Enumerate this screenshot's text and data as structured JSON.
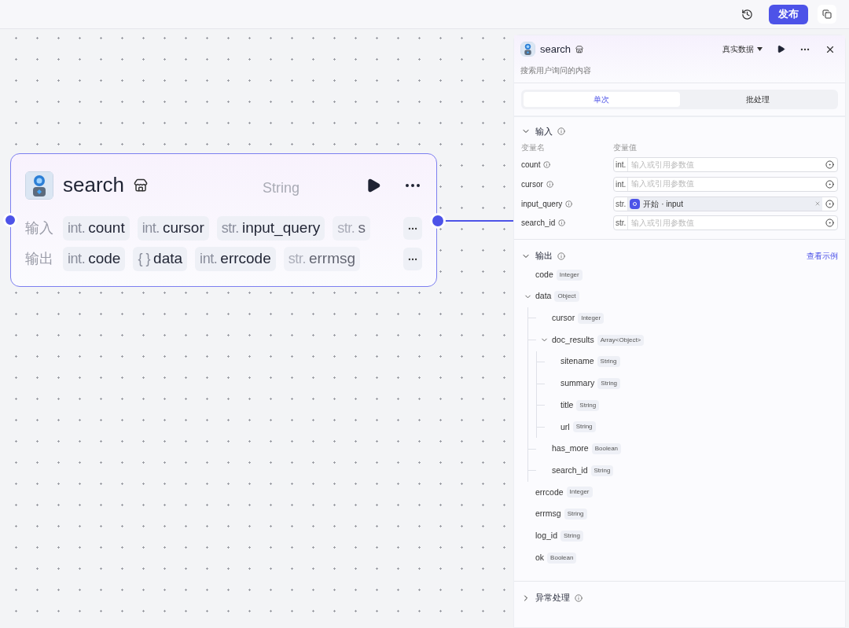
{
  "toolbar": {
    "publish": "发布"
  },
  "node": {
    "title": "search",
    "ghost_label": "String",
    "input_label": "输入",
    "output_label": "输出",
    "inputs": [
      {
        "type": "int.",
        "name": "count",
        "faded": false
      },
      {
        "type": "int.",
        "name": "cursor",
        "faded": false
      },
      {
        "type": "str.",
        "name": "input_query",
        "faded": false
      },
      {
        "type": "str.",
        "name": "s",
        "faded": true
      }
    ],
    "outputs": [
      {
        "type": "int.",
        "name": "code",
        "faded": false
      },
      {
        "type": "{ }",
        "name": "data",
        "faded": false
      },
      {
        "type": "int.",
        "name": "errcode",
        "faded": false
      },
      {
        "type": "str.",
        "name": "errmsg",
        "faded": true
      }
    ]
  },
  "panel": {
    "title": "search",
    "description": "搜索用户询问的内容",
    "data_mode": "真实数据",
    "tabs": [
      {
        "label": "单次",
        "selected": true
      },
      {
        "label": "批处理",
        "selected": false
      }
    ],
    "input": {
      "title": "输入",
      "expanded": true,
      "name_header": "变量名",
      "value_header": "变量值",
      "params": [
        {
          "name": "count",
          "type": "int.",
          "placeholder": "输入或引用参数值"
        },
        {
          "name": "cursor",
          "type": "int.",
          "placeholder": "输入或引用参数值"
        },
        {
          "name": "input_query",
          "type": "str.",
          "ref_node": "开始",
          "ref_separator": "·",
          "ref_var": "input"
        },
        {
          "name": "search_id",
          "type": "str.",
          "placeholder": "输入或引用参数值"
        }
      ]
    },
    "output": {
      "title": "输出",
      "expanded": true,
      "link": "查看示例",
      "fields": [
        {
          "name": "code",
          "type": "Integer"
        },
        {
          "name": "data",
          "type": "Object",
          "expanded": true,
          "children": [
            {
              "name": "cursor",
              "type": "Integer"
            },
            {
              "name": "doc_results",
              "type": "Array<Object>",
              "expanded": true,
              "children": [
                {
                  "name": "sitename",
                  "type": "String"
                },
                {
                  "name": "summary",
                  "type": "String"
                },
                {
                  "name": "title",
                  "type": "String"
                },
                {
                  "name": "url",
                  "type": "String"
                }
              ]
            },
            {
              "name": "has_more",
              "type": "Boolean"
            },
            {
              "name": "search_id",
              "type": "String"
            }
          ]
        },
        {
          "name": "errcode",
          "type": "Integer"
        },
        {
          "name": "errmsg",
          "type": "String"
        },
        {
          "name": "log_id",
          "type": "String"
        },
        {
          "name": "ok",
          "type": "Boolean"
        }
      ]
    },
    "error_handling": {
      "title": "异常处理",
      "expanded": false
    }
  }
}
